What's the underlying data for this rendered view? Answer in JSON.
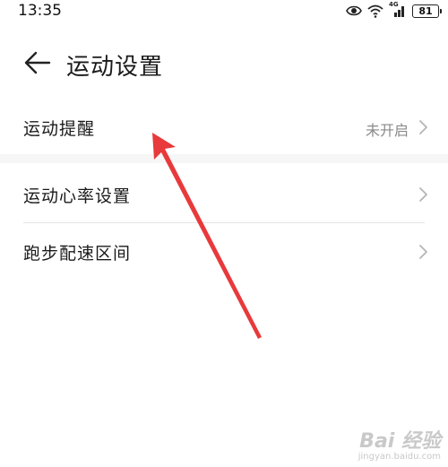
{
  "status_bar": {
    "time": "13:35",
    "network_label": "4G",
    "battery": "81"
  },
  "header": {
    "title": "运动设置",
    "back_icon": "arrow-left-icon"
  },
  "settings": {
    "reminder": {
      "label": "运动提醒",
      "value": "未开启"
    },
    "heart_rate": {
      "label": "运动心率设置"
    },
    "pace_zone": {
      "label": "跑步配速区间"
    }
  },
  "watermark": {
    "logo": "Bai 经验",
    "url": "jingyan.baidu.com"
  },
  "colors": {
    "annotation_arrow": "#e8393b",
    "background": "#f6f6f6",
    "card": "#ffffff"
  }
}
